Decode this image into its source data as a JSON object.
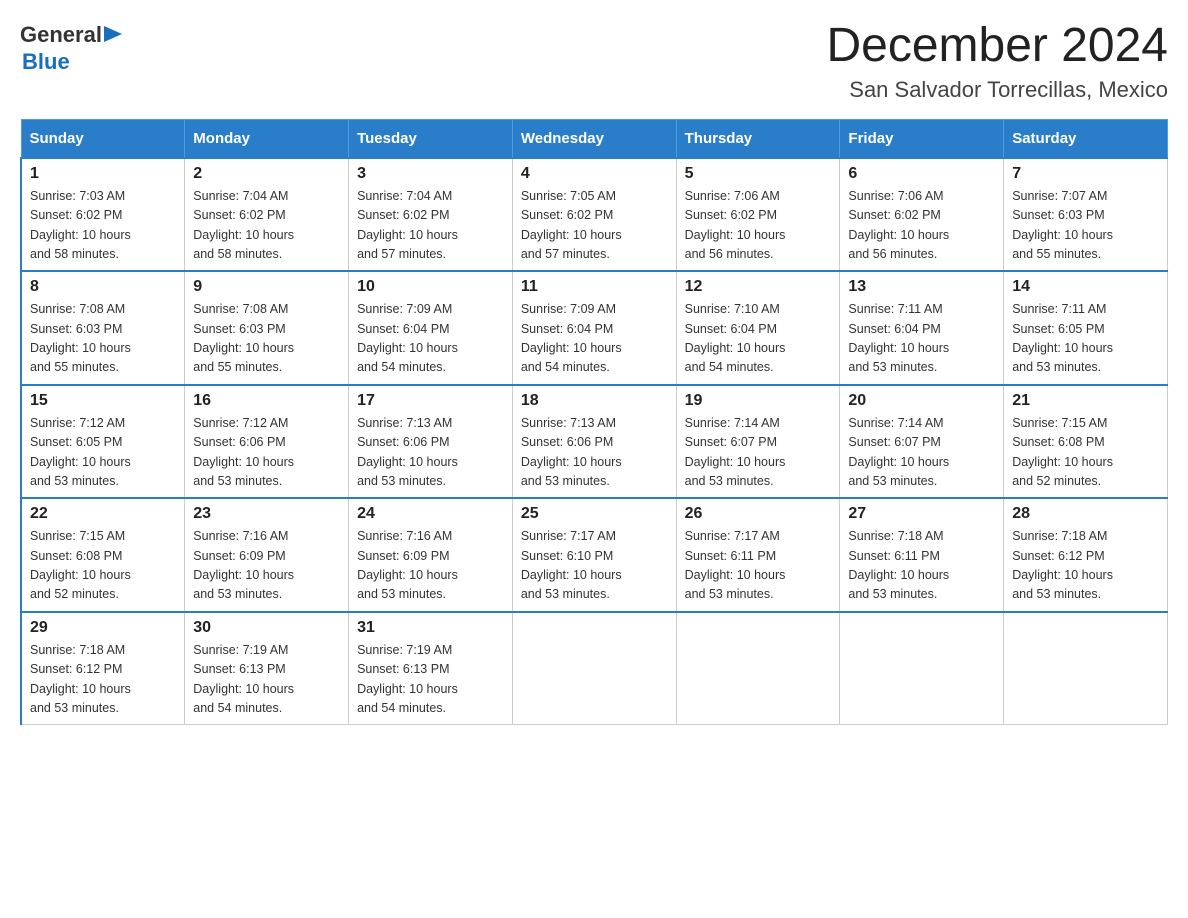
{
  "logo": {
    "text_general": "General",
    "triangle": "▶",
    "text_blue": "Blue"
  },
  "title": "December 2024",
  "subtitle": "San Salvador Torrecillas, Mexico",
  "days_of_week": [
    "Sunday",
    "Monday",
    "Tuesday",
    "Wednesday",
    "Thursday",
    "Friday",
    "Saturday"
  ],
  "weeks": [
    [
      {
        "day": "1",
        "sunrise": "7:03 AM",
        "sunset": "6:02 PM",
        "daylight": "10 hours and 58 minutes."
      },
      {
        "day": "2",
        "sunrise": "7:04 AM",
        "sunset": "6:02 PM",
        "daylight": "10 hours and 58 minutes."
      },
      {
        "day": "3",
        "sunrise": "7:04 AM",
        "sunset": "6:02 PM",
        "daylight": "10 hours and 57 minutes."
      },
      {
        "day": "4",
        "sunrise": "7:05 AM",
        "sunset": "6:02 PM",
        "daylight": "10 hours and 57 minutes."
      },
      {
        "day": "5",
        "sunrise": "7:06 AM",
        "sunset": "6:02 PM",
        "daylight": "10 hours and 56 minutes."
      },
      {
        "day": "6",
        "sunrise": "7:06 AM",
        "sunset": "6:02 PM",
        "daylight": "10 hours and 56 minutes."
      },
      {
        "day": "7",
        "sunrise": "7:07 AM",
        "sunset": "6:03 PM",
        "daylight": "10 hours and 55 minutes."
      }
    ],
    [
      {
        "day": "8",
        "sunrise": "7:08 AM",
        "sunset": "6:03 PM",
        "daylight": "10 hours and 55 minutes."
      },
      {
        "day": "9",
        "sunrise": "7:08 AM",
        "sunset": "6:03 PM",
        "daylight": "10 hours and 55 minutes."
      },
      {
        "day": "10",
        "sunrise": "7:09 AM",
        "sunset": "6:04 PM",
        "daylight": "10 hours and 54 minutes."
      },
      {
        "day": "11",
        "sunrise": "7:09 AM",
        "sunset": "6:04 PM",
        "daylight": "10 hours and 54 minutes."
      },
      {
        "day": "12",
        "sunrise": "7:10 AM",
        "sunset": "6:04 PM",
        "daylight": "10 hours and 54 minutes."
      },
      {
        "day": "13",
        "sunrise": "7:11 AM",
        "sunset": "6:04 PM",
        "daylight": "10 hours and 53 minutes."
      },
      {
        "day": "14",
        "sunrise": "7:11 AM",
        "sunset": "6:05 PM",
        "daylight": "10 hours and 53 minutes."
      }
    ],
    [
      {
        "day": "15",
        "sunrise": "7:12 AM",
        "sunset": "6:05 PM",
        "daylight": "10 hours and 53 minutes."
      },
      {
        "day": "16",
        "sunrise": "7:12 AM",
        "sunset": "6:06 PM",
        "daylight": "10 hours and 53 minutes."
      },
      {
        "day": "17",
        "sunrise": "7:13 AM",
        "sunset": "6:06 PM",
        "daylight": "10 hours and 53 minutes."
      },
      {
        "day": "18",
        "sunrise": "7:13 AM",
        "sunset": "6:06 PM",
        "daylight": "10 hours and 53 minutes."
      },
      {
        "day": "19",
        "sunrise": "7:14 AM",
        "sunset": "6:07 PM",
        "daylight": "10 hours and 53 minutes."
      },
      {
        "day": "20",
        "sunrise": "7:14 AM",
        "sunset": "6:07 PM",
        "daylight": "10 hours and 53 minutes."
      },
      {
        "day": "21",
        "sunrise": "7:15 AM",
        "sunset": "6:08 PM",
        "daylight": "10 hours and 52 minutes."
      }
    ],
    [
      {
        "day": "22",
        "sunrise": "7:15 AM",
        "sunset": "6:08 PM",
        "daylight": "10 hours and 52 minutes."
      },
      {
        "day": "23",
        "sunrise": "7:16 AM",
        "sunset": "6:09 PM",
        "daylight": "10 hours and 53 minutes."
      },
      {
        "day": "24",
        "sunrise": "7:16 AM",
        "sunset": "6:09 PM",
        "daylight": "10 hours and 53 minutes."
      },
      {
        "day": "25",
        "sunrise": "7:17 AM",
        "sunset": "6:10 PM",
        "daylight": "10 hours and 53 minutes."
      },
      {
        "day": "26",
        "sunrise": "7:17 AM",
        "sunset": "6:11 PM",
        "daylight": "10 hours and 53 minutes."
      },
      {
        "day": "27",
        "sunrise": "7:18 AM",
        "sunset": "6:11 PM",
        "daylight": "10 hours and 53 minutes."
      },
      {
        "day": "28",
        "sunrise": "7:18 AM",
        "sunset": "6:12 PM",
        "daylight": "10 hours and 53 minutes."
      }
    ],
    [
      {
        "day": "29",
        "sunrise": "7:18 AM",
        "sunset": "6:12 PM",
        "daylight": "10 hours and 53 minutes."
      },
      {
        "day": "30",
        "sunrise": "7:19 AM",
        "sunset": "6:13 PM",
        "daylight": "10 hours and 54 minutes."
      },
      {
        "day": "31",
        "sunrise": "7:19 AM",
        "sunset": "6:13 PM",
        "daylight": "10 hours and 54 minutes."
      },
      null,
      null,
      null,
      null
    ]
  ],
  "labels": {
    "sunrise": "Sunrise:",
    "sunset": "Sunset:",
    "daylight": "Daylight:"
  }
}
